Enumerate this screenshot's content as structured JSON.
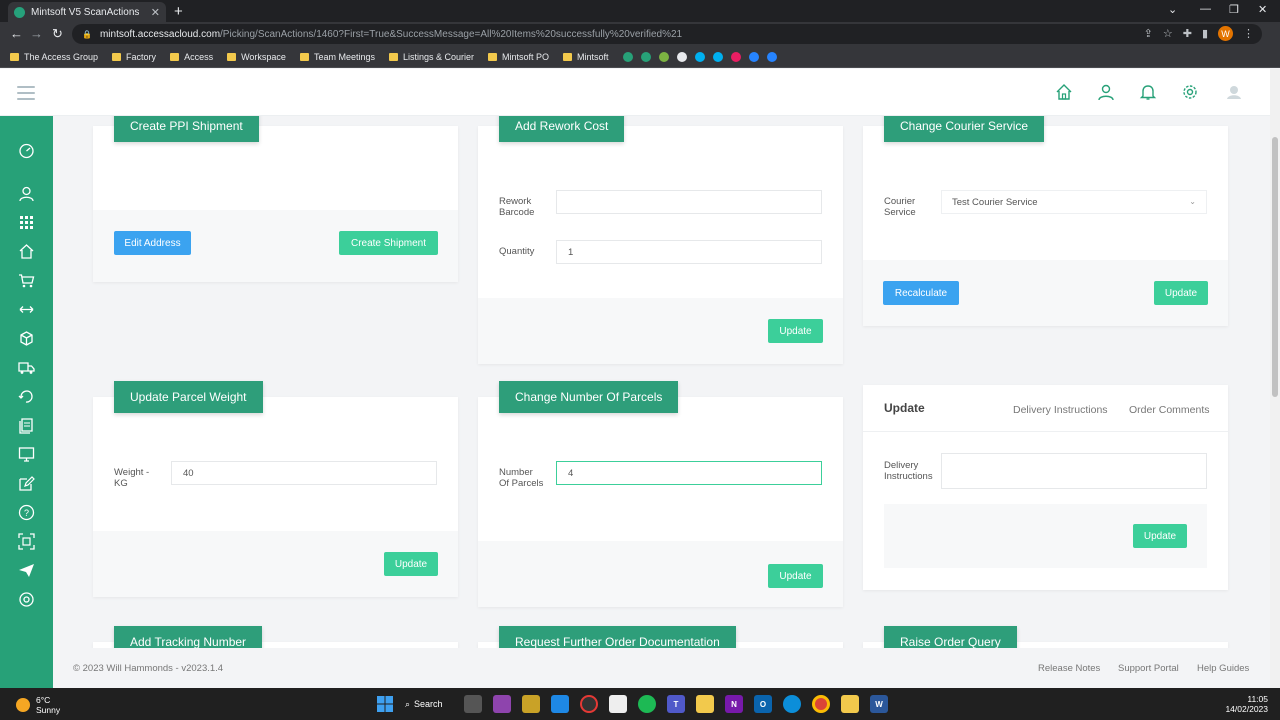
{
  "browser": {
    "tab_title": "Mintsoft V5 ScanActions",
    "url_host": "mintsoft.accessacloud.com",
    "url_path": "/Picking/ScanActions/1460?First=True&SuccessMessage=All%20Items%20successfully%20verified%21",
    "profile_initial": "W",
    "bookmarks": [
      "The Access Group",
      "Factory",
      "Access",
      "Workspace",
      "Team Meetings",
      "Listings & Courier",
      "Mintsoft PO",
      "Mintsoft"
    ]
  },
  "cards": {
    "ppi": {
      "title": "Create PPI Shipment",
      "edit_address": "Edit Address",
      "create_shipment": "Create Shipment"
    },
    "rework": {
      "title": "Add Rework Cost",
      "barcode_label": "Rework Barcode",
      "barcode_value": "",
      "quantity_label": "Quantity",
      "quantity_value": "1",
      "update": "Update"
    },
    "courier": {
      "title": "Change Courier Service",
      "service_label": "Courier Service",
      "service_value": "Test Courier Service",
      "recalculate": "Recalculate",
      "update": "Update"
    },
    "weight": {
      "title": "Update Parcel Weight",
      "weight_label": "Weight - KG",
      "weight_value": "40",
      "update": "Update"
    },
    "parcels": {
      "title": "Change Number Of Parcels",
      "parcels_label": "Number Of Parcels",
      "parcels_value": "4",
      "update": "Update"
    },
    "instructions": {
      "title": "Update",
      "tab_delivery": "Delivery Instructions",
      "tab_comments": "Order Comments",
      "delivery_label": "Delivery Instructions",
      "delivery_value": "",
      "update": "Update"
    },
    "tracking": {
      "title": "Add Tracking Number"
    },
    "documentation": {
      "title": "Request Further Order Documentation"
    },
    "query": {
      "title": "Raise Order Query"
    }
  },
  "footer": {
    "copyright": "© 2023 Will Hammonds - v2023.1.4",
    "release_notes": "Release Notes",
    "support_portal": "Support Portal",
    "help_guides": "Help Guides"
  },
  "taskbar": {
    "temperature": "6°C",
    "condition": "Sunny",
    "search": "Search",
    "time": "11:05",
    "date": "14/02/2023"
  },
  "colors": {
    "brand_green": "#27a178",
    "title_green": "#2e9e7a",
    "button_green": "#3ccf9a",
    "button_blue": "#3ba3f0"
  }
}
